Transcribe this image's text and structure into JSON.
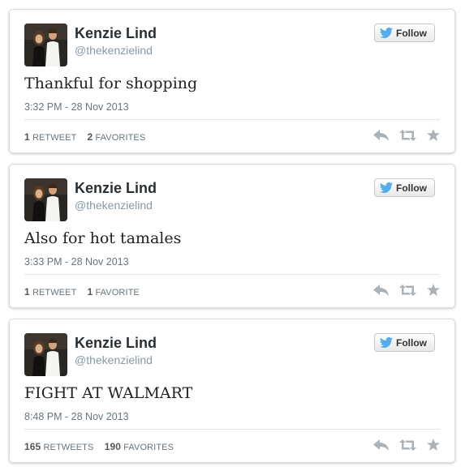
{
  "tweets": [
    {
      "name": "Kenzie Lind",
      "handle": "@thekenzielind",
      "follow_label": "Follow",
      "text": "Thankful for shopping",
      "timestamp": "3:32 PM - 28 Nov 2013",
      "retweet_count": "1",
      "retweet_label": "RETWEET",
      "favorite_count": "2",
      "favorite_label": "FAVORITES"
    },
    {
      "name": "Kenzie Lind",
      "handle": "@thekenzielind",
      "follow_label": "Follow",
      "text": "Also for hot tamales",
      "timestamp": "3:33 PM - 28 Nov 2013",
      "retweet_count": "1",
      "retweet_label": "RETWEET",
      "favorite_count": "1",
      "favorite_label": "FAVORITE"
    },
    {
      "name": "Kenzie Lind",
      "handle": "@thekenzielind",
      "follow_label": "Follow",
      "text": "FIGHT AT WALMART",
      "timestamp": "8:48 PM - 28 Nov 2013",
      "retweet_count": "165",
      "retweet_label": "RETWEETS",
      "favorite_count": "190",
      "favorite_label": "FAVORITES"
    }
  ],
  "icons": {
    "follow": "twitter-bird-icon",
    "reply": "reply-icon",
    "retweet": "retweet-icon",
    "favorite": "star-icon"
  },
  "colors": {
    "twitter_blue": "#55acee",
    "action_gray": "#aab1b8"
  }
}
